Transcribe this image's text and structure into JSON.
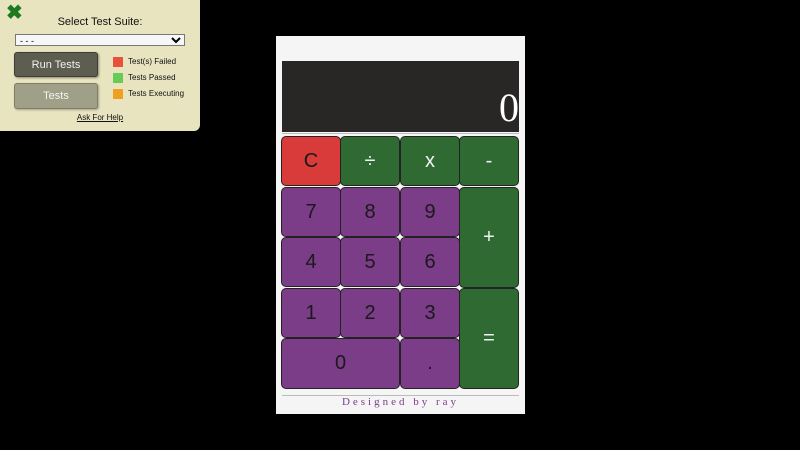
{
  "test_panel": {
    "close_icon": "✖",
    "suite_label": "Select Test Suite:",
    "suite_select_value": "- - -",
    "run_tests_label": "Run Tests",
    "tests_label": "Tests",
    "legend": [
      {
        "label": "Test(s) Failed",
        "color": "#e8513a"
      },
      {
        "label": "Tests Passed",
        "color": "#66cc55"
      },
      {
        "label": "Tests Executing",
        "color": "#f0a020"
      }
    ],
    "help_link": "Ask For Help"
  },
  "calculator": {
    "display_value": "0",
    "keys": {
      "clear": "C",
      "divide": "÷",
      "multiply": "x",
      "subtract": "-",
      "add": "+",
      "equals": "=",
      "decimal": ".",
      "d0": "0",
      "d1": "1",
      "d2": "2",
      "d3": "3",
      "d4": "4",
      "d5": "5",
      "d6": "6",
      "d7": "7",
      "d8": "8",
      "d9": "9"
    },
    "footer": "Designed by ray",
    "colors": {
      "number_key": "#7b3c88",
      "operator_key": "#2f6a33",
      "clear_key": "#d93a3a",
      "display_bg": "#292626"
    }
  }
}
